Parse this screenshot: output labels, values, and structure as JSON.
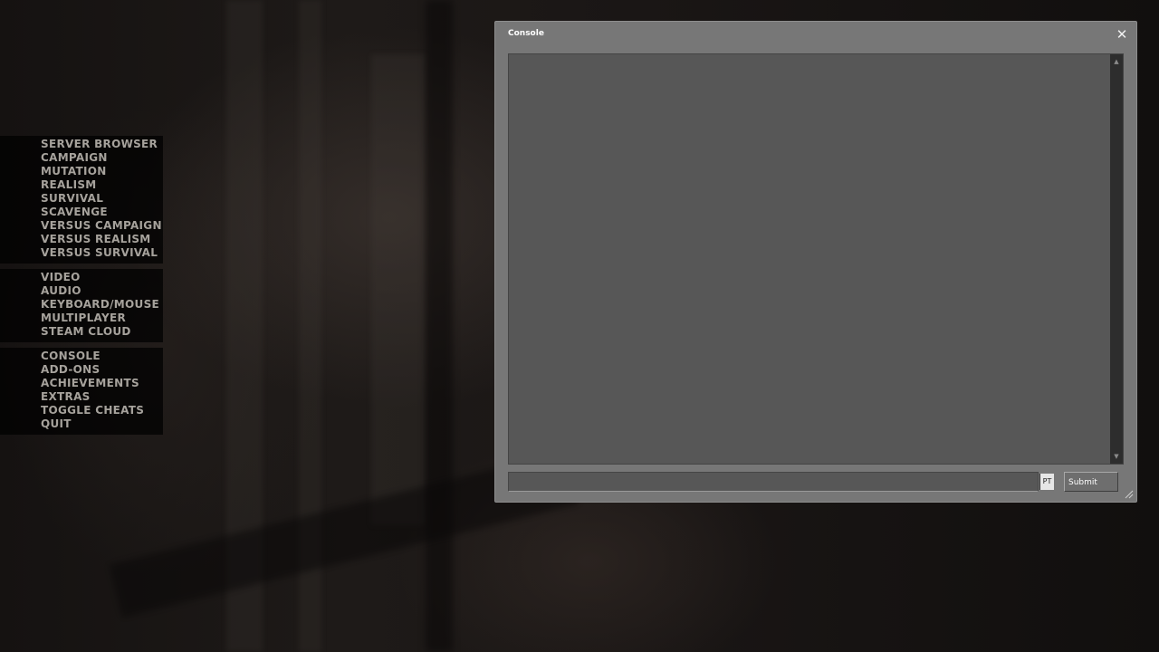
{
  "main_menu": {
    "groups": [
      {
        "items": [
          {
            "label": "SERVER BROWSER"
          },
          {
            "label": "CAMPAIGN"
          },
          {
            "label": "MUTATION"
          },
          {
            "label": "REALISM"
          },
          {
            "label": "SURVIVAL"
          },
          {
            "label": "SCAVENGE"
          },
          {
            "label": "VERSUS CAMPAIGN"
          },
          {
            "label": "VERSUS REALISM"
          },
          {
            "label": "VERSUS SURVIVAL"
          }
        ]
      },
      {
        "items": [
          {
            "label": "VIDEO"
          },
          {
            "label": "AUDIO"
          },
          {
            "label": "KEYBOARD/MOUSE"
          },
          {
            "label": "MULTIPLAYER"
          },
          {
            "label": "STEAM CLOUD"
          }
        ]
      },
      {
        "items": [
          {
            "label": "CONSOLE"
          },
          {
            "label": "ADD-ONS"
          },
          {
            "label": "ACHIEVEMENTS"
          },
          {
            "label": "EXTRAS"
          },
          {
            "label": "TOGGLE CHEATS"
          },
          {
            "label": "QUIT"
          }
        ]
      }
    ]
  },
  "console": {
    "title": "Console",
    "close_icon": "close-icon",
    "output_text": "",
    "input_value": "",
    "language_badge": "PT",
    "submit_label": "Submit"
  },
  "colors": {
    "menu_text": "#a6a29c",
    "window_bg": "#777777",
    "output_bg": "#575757"
  }
}
